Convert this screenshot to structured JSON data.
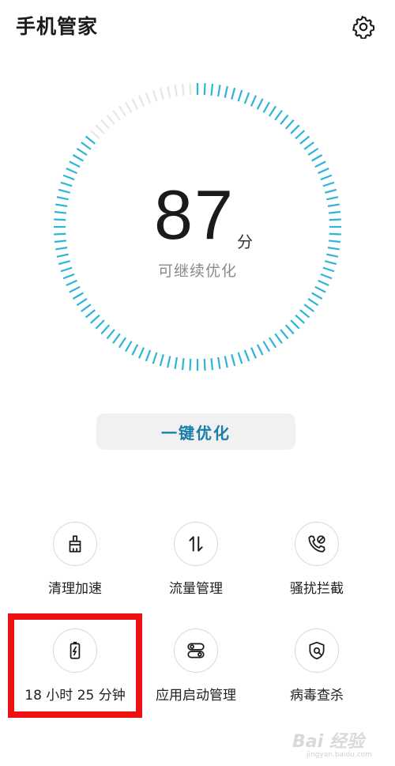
{
  "header": {
    "title": "手机管家"
  },
  "score": {
    "value": "87",
    "unit": "分",
    "status": "可继续优化",
    "fraction": 0.87
  },
  "actions": {
    "optimize_label": "一键优化"
  },
  "tools": [
    {
      "label": "清理加速",
      "icon": "broom-icon"
    },
    {
      "label": "流量管理",
      "icon": "data-transfer-icon"
    },
    {
      "label": "骚扰拦截",
      "icon": "blocked-call-icon"
    },
    {
      "label": "18 小时 25 分钟",
      "icon": "battery-icon"
    },
    {
      "label": "应用启动管理",
      "icon": "app-launch-icon"
    },
    {
      "label": "病毒查杀",
      "icon": "virus-scan-icon"
    }
  ],
  "colors": {
    "gauge_active": "#2bb5d6",
    "gauge_inactive": "#e6e6e6",
    "accent": "#1a7fa8",
    "highlight": "#ee1111"
  },
  "watermark": {
    "brand": "Bai 经验",
    "url": "jingyan.baidu.com"
  }
}
